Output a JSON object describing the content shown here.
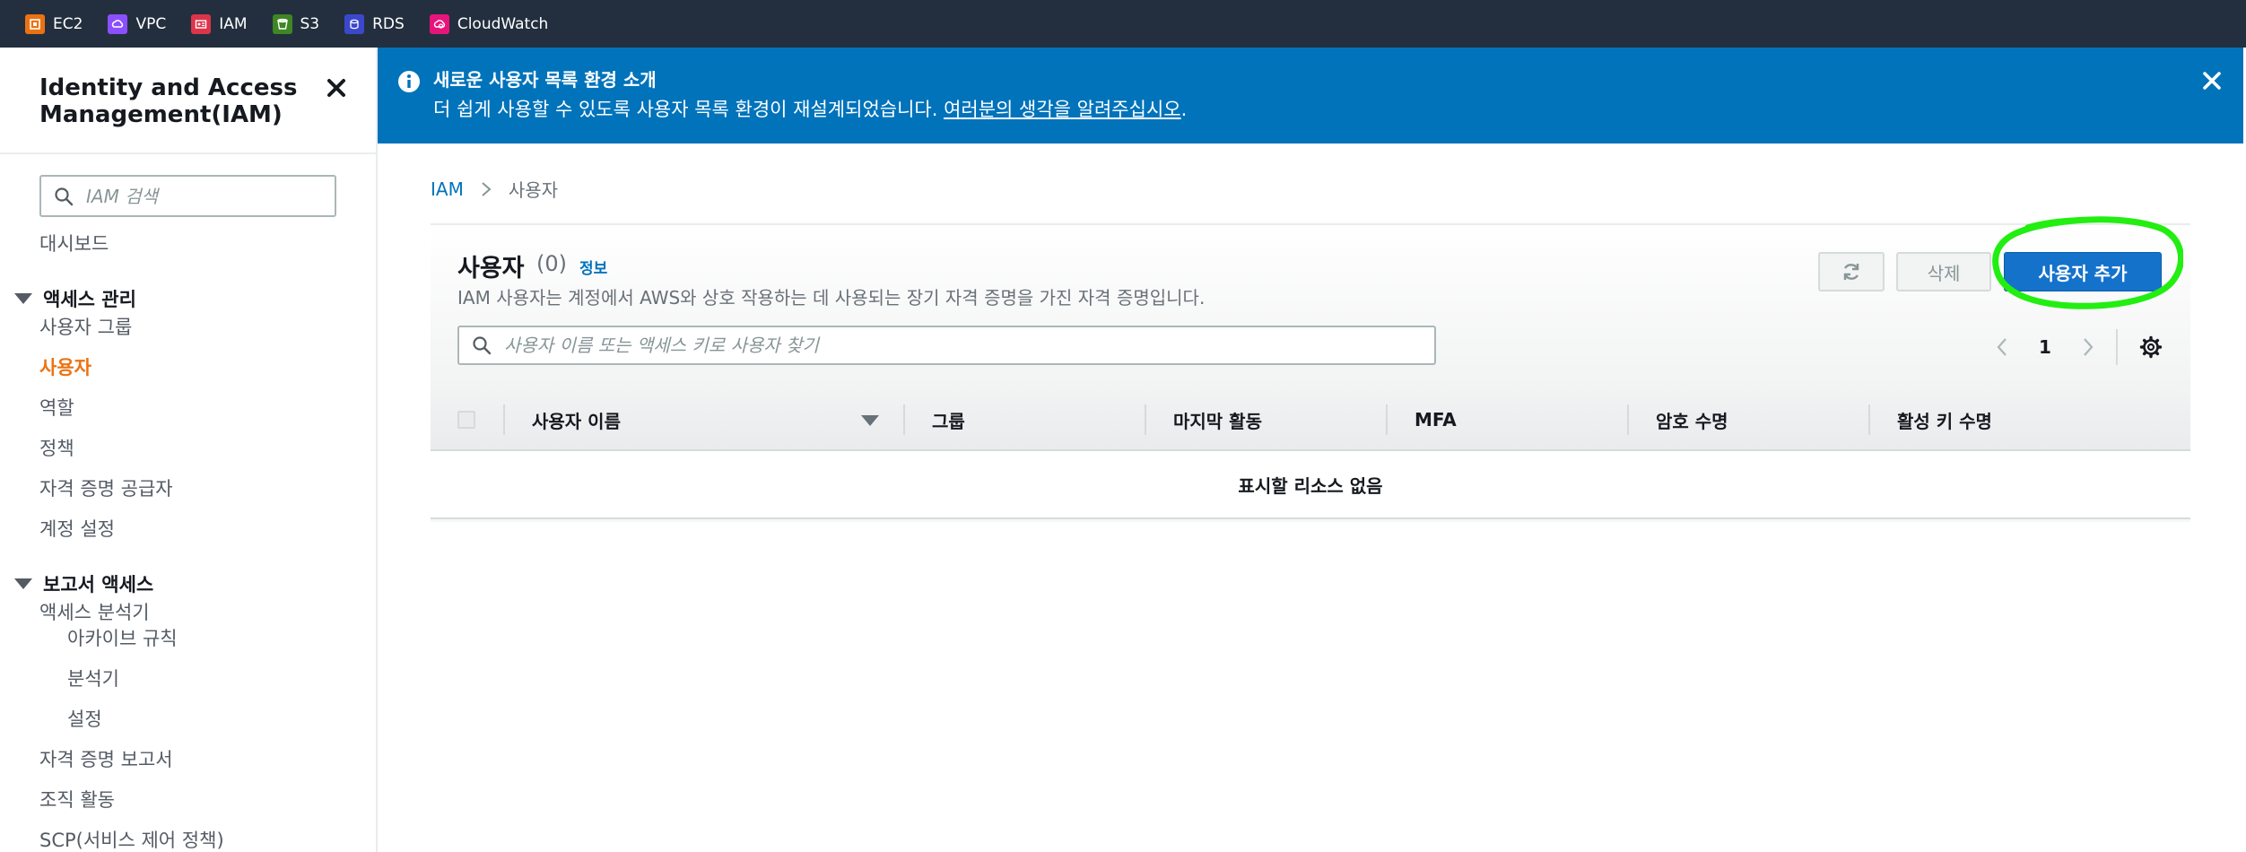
{
  "favorites": [
    {
      "label": "EC2",
      "color": "#ec7211",
      "icon": "ec2-icon"
    },
    {
      "label": "VPC",
      "color": "#8c4fff",
      "icon": "vpc-icon"
    },
    {
      "label": "IAM",
      "color": "#dd344c",
      "icon": "iam-icon"
    },
    {
      "label": "S3",
      "color": "#3f8624",
      "icon": "s3-icon"
    },
    {
      "label": "RDS",
      "color": "#3b48cc",
      "icon": "rds-icon"
    },
    {
      "label": "CloudWatch",
      "color": "#e7157b",
      "icon": "cloudwatch-icon"
    }
  ],
  "sidebar": {
    "title": "Identity and Access Management(IAM)",
    "search_placeholder": "IAM 검색",
    "dashboard": "대시보드",
    "access_section": "액세스 관리",
    "access_items": [
      "사용자 그룹",
      "사용자",
      "역할",
      "정책",
      "자격 증명 공급자",
      "계정 설정"
    ],
    "active_item": "사용자",
    "reports_section": "보고서 액세스",
    "analyzer": "액세스 분석기",
    "analyzer_items": [
      "아카이브 규칙",
      "분석기",
      "설정"
    ],
    "report_items": [
      "자격 증명 보고서",
      "조직 활동",
      "SCP(서비스 제어 정책)"
    ]
  },
  "flash": {
    "title": "새로운 사용자 목록 환경 소개",
    "text": "더 쉽게 사용할 수 있도록 사용자 목록 환경이 재설계되었습니다. ",
    "link": "여러분의 생각을 알려주십시오",
    "suffix": ".",
    "color": "#0073bb"
  },
  "breadcrumb": {
    "root": "IAM",
    "current": "사용자"
  },
  "users_panel": {
    "title": "사용자",
    "count": "(0)",
    "info": "정보",
    "description": "IAM 사용자는 계정에서 AWS와 상호 작용하는 데 사용되는 장기 자격 증명을 가진 자격 증명입니다.",
    "delete_label": "삭제",
    "add_label": "사용자 추가",
    "search_placeholder": "사용자 이름 또는 액세스 키로 사용자 찾기",
    "page": "1",
    "columns": [
      "사용자 이름",
      "그룹",
      "마지막 활동",
      "MFA",
      "암호 수명",
      "활성 키 수명"
    ],
    "empty_text": "표시할 리소스 없음",
    "accent": "#1572cb",
    "highlight_color": "#22ee11"
  }
}
